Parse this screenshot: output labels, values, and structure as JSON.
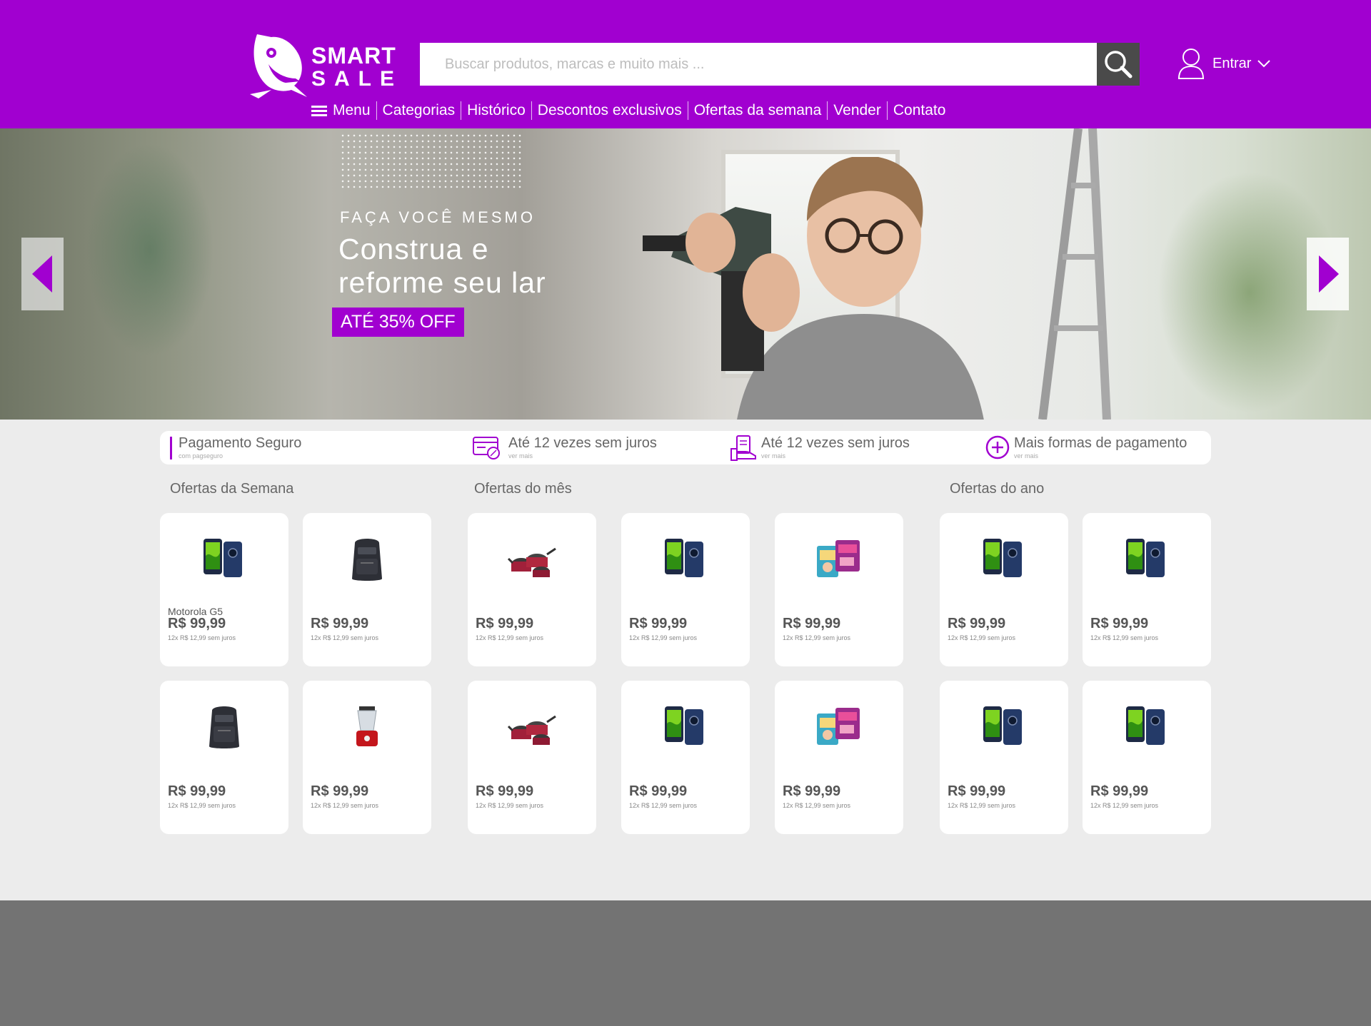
{
  "brand": {
    "line1": "SMART",
    "line2": "SALE",
    "color": "#a100d0"
  },
  "search": {
    "placeholder": "Buscar produtos, marcas e muito mais ...",
    "icon": "search-icon"
  },
  "login": {
    "label": "Entrar",
    "icon": "user-icon"
  },
  "nav": {
    "items": [
      {
        "label": "Menu",
        "icon": "hamburger-icon"
      },
      {
        "label": "Categorias"
      },
      {
        "label": "Histórico"
      },
      {
        "label": "Descontos exclusivos"
      },
      {
        "label": "Ofertas da semana"
      },
      {
        "label": "Vender"
      },
      {
        "label": "Contato"
      }
    ]
  },
  "banner": {
    "kicker": "FAÇA VOCÊ MESMO",
    "title": "Construa e reforme seu lar",
    "badge": "ATÉ 35% OFF",
    "slide_count": 4,
    "active_slide": 2
  },
  "payment": [
    {
      "title": "Pagamento Seguro",
      "subtitle": "com pagseguro",
      "icon": "divider-bar"
    },
    {
      "title": "Até 12 vezes sem juros",
      "subtitle": "ver mais",
      "icon": "card-discount-icon"
    },
    {
      "title": "Até 12 vezes sem juros",
      "subtitle": "ver mais",
      "icon": "hand-money-icon"
    },
    {
      "title": "Mais formas de pagamento",
      "subtitle": "ver mais",
      "icon": "plus-circle-icon"
    }
  ],
  "sections": [
    {
      "title": "Ofertas da Semana"
    },
    {
      "title": "Ofertas do mês"
    },
    {
      "title": "Ofertas do ano"
    }
  ],
  "products": [
    {
      "name": "Motorola G5",
      "price": "R$ 99,99",
      "installments": "12x R$ 12,99 sem juros",
      "image": "smartphone"
    },
    {
      "name": "",
      "price": "R$ 99,99",
      "installments": "12x R$ 12,99 sem juros",
      "image": "backpack"
    },
    {
      "name": "",
      "price": "R$ 99,99",
      "installments": "12x R$ 12,99 sem juros",
      "image": "cookware-set"
    },
    {
      "name": "",
      "price": "R$ 99,99",
      "installments": "12x R$ 12,99 sem juros",
      "image": "smartphone"
    },
    {
      "name": "",
      "price": "R$ 99,99",
      "installments": "12x R$ 12,99 sem juros",
      "image": "diapers"
    },
    {
      "name": "",
      "price": "R$ 99,99",
      "installments": "12x R$ 12,99 sem juros",
      "image": "smartphone"
    },
    {
      "name": "",
      "price": "R$ 99,99",
      "installments": "12x R$ 12,99 sem juros",
      "image": "smartphone"
    },
    {
      "name": "",
      "price": "R$ 99,99",
      "installments": "12x R$ 12,99 sem juros",
      "image": "backpack"
    },
    {
      "name": "",
      "price": "R$ 99,99",
      "installments": "12x R$ 12,99 sem juros",
      "image": "blender"
    },
    {
      "name": "",
      "price": "R$ 99,99",
      "installments": "12x R$ 12,99 sem juros",
      "image": "cookware-set"
    },
    {
      "name": "",
      "price": "R$ 99,99",
      "installments": "12x R$ 12,99 sem juros",
      "image": "smartphone"
    },
    {
      "name": "",
      "price": "R$ 99,99",
      "installments": "12x R$ 12,99 sem juros",
      "image": "diapers"
    },
    {
      "name": "",
      "price": "R$ 99,99",
      "installments": "12x R$ 12,99 sem juros",
      "image": "smartphone"
    },
    {
      "name": "",
      "price": "R$ 99,99",
      "installments": "12x R$ 12,99 sem juros",
      "image": "smartphone"
    }
  ]
}
